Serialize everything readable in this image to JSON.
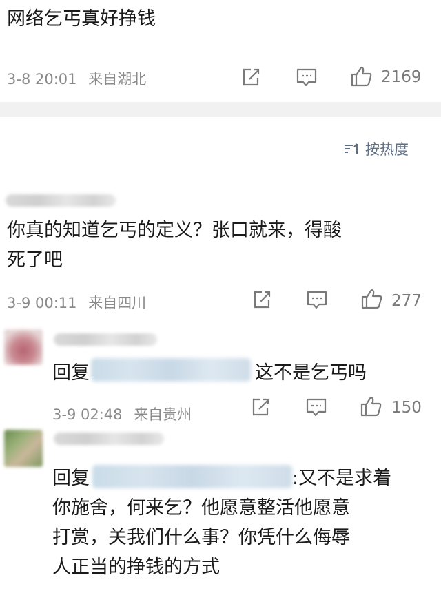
{
  "post": {
    "text": "网络乞丐真好挣钱",
    "time": "3-8 20:01",
    "source": "来自湖北",
    "like_count": "2169"
  },
  "sort_label": "按热度",
  "comments": [
    {
      "lines": [
        "你真的知道乞丐的定义？张口就来，得酸",
        "死了吧"
      ],
      "time": "3-9 00:11",
      "source": "来自四川",
      "like_count": "277"
    },
    {
      "reply_prefix": "回复",
      "text": "这不是乞丐吗",
      "time": "3-9 02:48",
      "source": "来自贵州",
      "like_count": "150"
    },
    {
      "reply_prefix": "回复",
      "lines": [
        ":又不是求着",
        "你施舍，何来乞？他愿意整活他愿意",
        "打赏，关我们什么事？你凭什么侮辱",
        "人正当的挣钱的方式"
      ]
    }
  ],
  "icons": [
    "share-icon",
    "comment-icon",
    "like-icon",
    "sort-icon"
  ]
}
